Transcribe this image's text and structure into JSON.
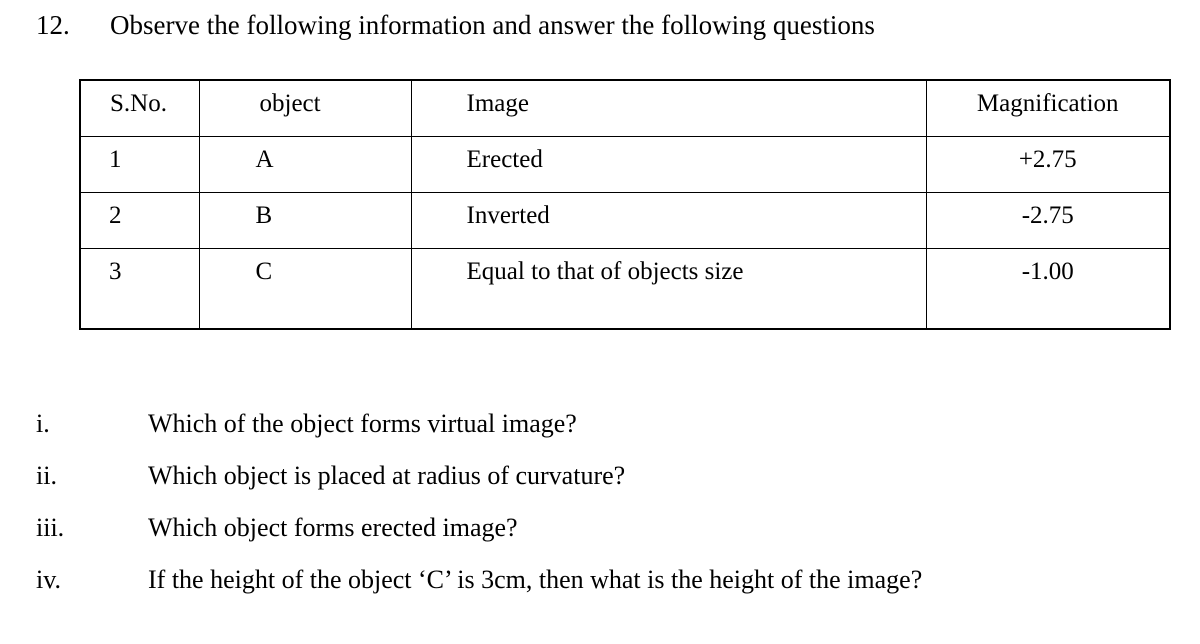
{
  "heading": {
    "number": "12.",
    "text": "Observe the following information and answer the following questions"
  },
  "table": {
    "columns": [
      "S.No.",
      "object",
      "Image",
      "Magnification"
    ],
    "rows": [
      {
        "sno": "1",
        "object": "A",
        "image": "Erected",
        "magnification": "+2.75"
      },
      {
        "sno": "2",
        "object": "B",
        "image": "Inverted",
        "magnification": "-2.75"
      },
      {
        "sno": "3",
        "object": "C",
        "image": "Equal to that of objects size",
        "magnification": "-1.00"
      }
    ]
  },
  "sub_questions": [
    {
      "marker": "i.",
      "text": "Which of the object forms virtual image?"
    },
    {
      "marker": "ii.",
      "text": "Which object is placed at radius of curvature?"
    },
    {
      "marker": "iii.",
      "text": "Which object forms erected image?"
    },
    {
      "marker": "iv.",
      "text": "If the height of the object ‘C’ is 3cm, then what is the height of the image?"
    }
  ]
}
